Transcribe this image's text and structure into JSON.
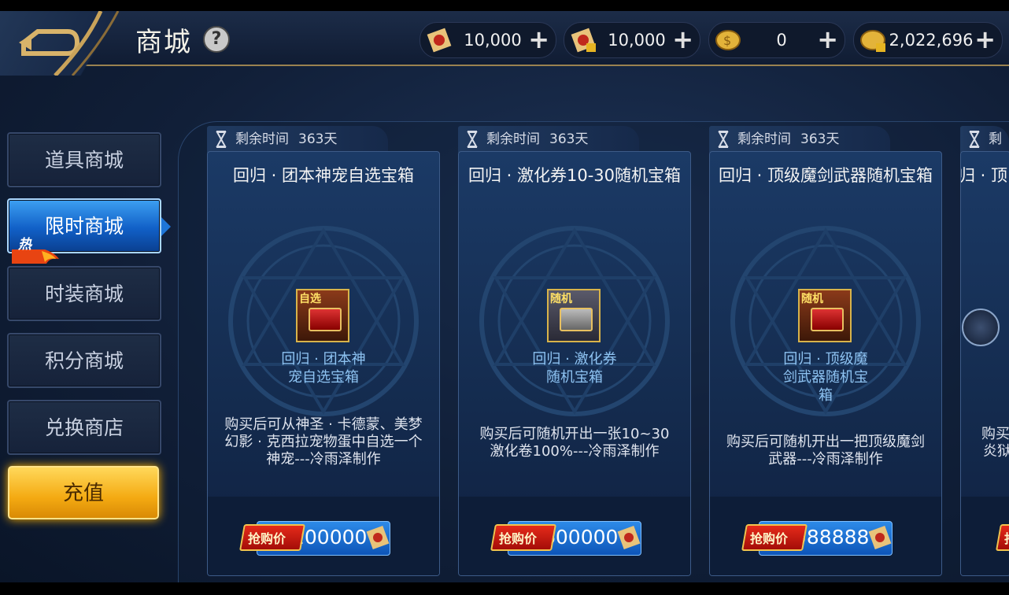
{
  "header": {
    "title": "商城",
    "help": "?",
    "currencies": [
      {
        "icon": "red-scroll-icon",
        "value": "10,000"
      },
      {
        "icon": "locked-red-scroll-icon",
        "value": "10,000"
      },
      {
        "icon": "gold-coin-icon",
        "value": "0"
      },
      {
        "icon": "locked-gold-coin-icon",
        "value": "2,022,696"
      }
    ],
    "plus": "+"
  },
  "sidebar": {
    "items": [
      {
        "label": "道具商城"
      },
      {
        "label": "限时商城",
        "badge": "热"
      },
      {
        "label": "时装商城"
      },
      {
        "label": "积分商城"
      },
      {
        "label": "兑换商店"
      }
    ],
    "recharge": "充值"
  },
  "cards": [
    {
      "timer_label": "剩余时间",
      "timer_value": "363天",
      "title": "回归 · 团本神宠自选宝箱",
      "icon_tag": "自选",
      "item_name": "回归 · 团本神宠自选宝箱",
      "desc": "购买后可从神圣 · 卡德蒙、美梦幻影 · 克西拉宠物蛋中自选一个神宠---冷雨泽制作",
      "badge": "抢购价",
      "price": "200000"
    },
    {
      "timer_label": "剩余时间",
      "timer_value": "363天",
      "title": "回归 · 激化券10-30随机宝箱",
      "icon_tag": "随机",
      "item_name": "回归 · 激化券随机宝箱",
      "desc": "购买后可随机开出一张10~30激化卷100%---冷雨泽制作",
      "badge": "抢购价",
      "price": "600000"
    },
    {
      "timer_label": "剩余时间",
      "timer_value": "363天",
      "title": "回归 · 顶级魔剑武器随机宝箱",
      "icon_tag": "随机",
      "item_name": "回归 · 顶级魔剑武器随机宝箱",
      "desc": "购买后可随机开出一把顶级魔剑武器---冷雨泽制作",
      "badge": "抢购价",
      "price": "588888"
    },
    {
      "timer_label": "剩余",
      "title": "回归 · 顶",
      "desc": "购买",
      "desc2": "炎狱",
      "badge": "抢"
    }
  ]
}
